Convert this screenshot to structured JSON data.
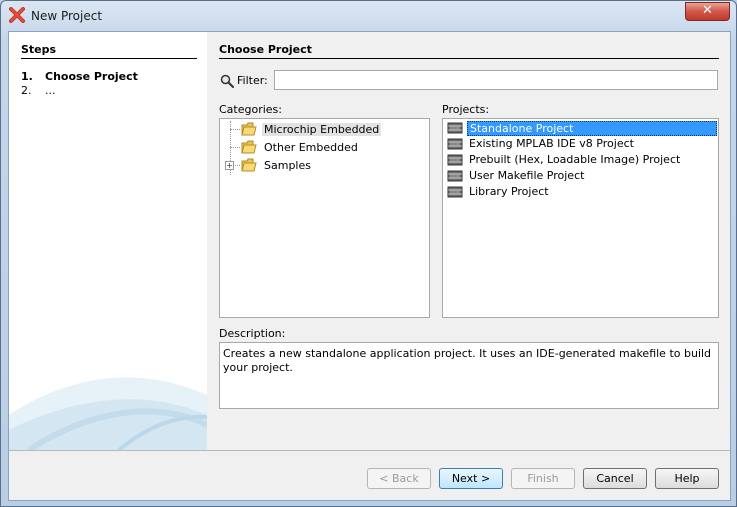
{
  "window": {
    "title": "New Project",
    "close_label": "✕"
  },
  "steps": {
    "title": "Steps",
    "items": [
      {
        "num": "1.",
        "label": "Choose Project"
      },
      {
        "num": "2.",
        "label": "..."
      }
    ]
  },
  "main": {
    "title": "Choose Project",
    "filter_label": "Filter:",
    "filter_value": "",
    "categories_label": "Categories:",
    "projects_label": "Projects:",
    "categories": [
      {
        "label": "Microchip Embedded",
        "selected": true,
        "expandable": false
      },
      {
        "label": "Other Embedded",
        "selected": false,
        "expandable": false
      },
      {
        "label": "Samples",
        "selected": false,
        "expandable": true
      }
    ],
    "projects": [
      {
        "label": "Standalone Project",
        "selected": true
      },
      {
        "label": "Existing MPLAB IDE v8 Project",
        "selected": false
      },
      {
        "label": "Prebuilt (Hex, Loadable Image) Project",
        "selected": false
      },
      {
        "label": "User Makefile Project",
        "selected": false
      },
      {
        "label": "Library Project",
        "selected": false
      }
    ],
    "description_label": "Description:",
    "description": "Creates a new standalone application project. It uses an IDE-generated makefile to build your project."
  },
  "buttons": {
    "back": "< Back",
    "next": "Next >",
    "finish": "Finish",
    "cancel": "Cancel",
    "help": "Help"
  },
  "colors": {
    "selection": "#3399ff",
    "accent": "#3c7fb1"
  },
  "icons": {
    "filter": "search-icon",
    "category": "folder-icon",
    "project": "project-chip-icon",
    "app": "mplab-x-icon"
  }
}
